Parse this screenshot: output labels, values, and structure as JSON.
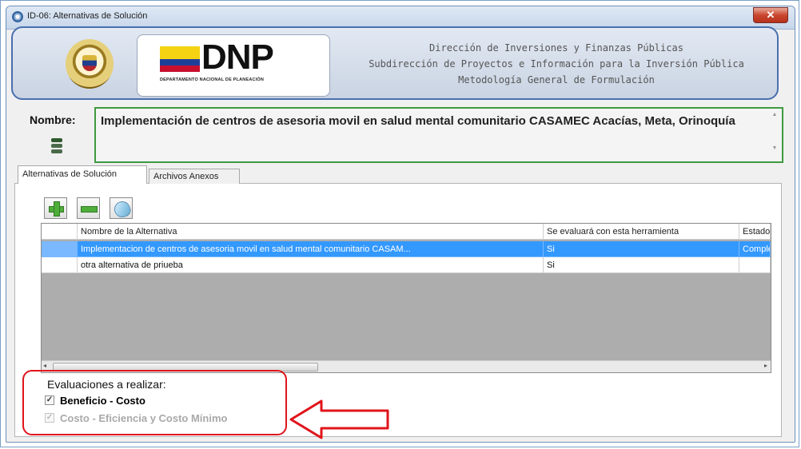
{
  "window": {
    "title": "ID-06: Alternativas de Solución",
    "close_glyph": "✕"
  },
  "banner": {
    "logo_text": "DNP",
    "logo_subtitle": "DEPARTAMENTO NACIONAL DE PLANEACIÓN",
    "lines": [
      "Dirección de Inversiones y Finanzas Públicas",
      "Subdirección de Proyectos e Información para la Inversión Pública",
      "Metodología General de Formulación"
    ]
  },
  "nombre": {
    "label": "Nombre:",
    "value": "Implementación de centros de asesoria movil en salud mental comunitario CASAMEC Acacías, Meta, Orinoquía"
  },
  "tabs": [
    {
      "label": "Alternativas de Solución",
      "active": true
    },
    {
      "label": "Archivos Anexos",
      "active": false
    }
  ],
  "toolbar": {
    "add_icon": "plus-icon",
    "remove_icon": "minus-icon",
    "edit_icon": "edit-icon"
  },
  "grid": {
    "columns": [
      "Nombre de la Alternativa",
      "Se evaluará con esta herramienta",
      "Estado"
    ],
    "rows": [
      {
        "nombre": "Implementacion de centros de asesoria movil en salud mental comunitario CASAM...",
        "evaluara": "Si",
        "estado": "Completo",
        "selected": true
      },
      {
        "nombre": "otra alternativa de priueba",
        "evaluara": "Si",
        "estado": "",
        "selected": false
      }
    ],
    "scroll_left": "◂",
    "scroll_right": "▸"
  },
  "evaluaciones": {
    "title": "Evaluaciones a realizar:",
    "options": [
      {
        "label": "Beneficio - Costo",
        "checked": true,
        "enabled": true
      },
      {
        "label": "Costo - Eficiencia y Costo Mínimo",
        "checked": true,
        "enabled": false
      }
    ],
    "check_glyph": "✓"
  },
  "colors": {
    "highlight_border": "#e0141b",
    "selection": "#3399ff",
    "name_border": "#3e9a3e"
  }
}
